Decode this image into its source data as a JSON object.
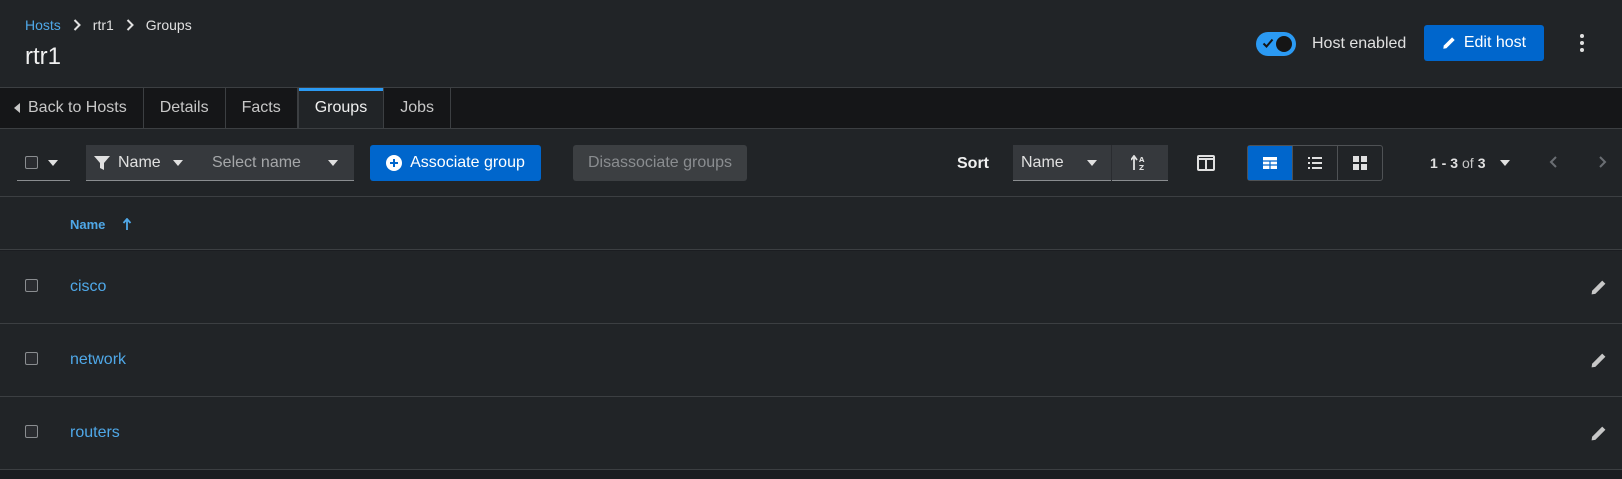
{
  "breadcrumb": {
    "items": [
      "Hosts",
      "rtr1",
      "Groups"
    ]
  },
  "header": {
    "title": "rtr1",
    "toggle_label": "Host enabled",
    "edit_button": "Edit host"
  },
  "tabs": [
    {
      "label": "Back to Hosts"
    },
    {
      "label": "Details"
    },
    {
      "label": "Facts"
    },
    {
      "label": "Groups"
    },
    {
      "label": "Jobs"
    }
  ],
  "toolbar": {
    "filter_label": "Name",
    "filter_placeholder": "Select name",
    "associate_button": "Associate group",
    "disassociate_button": "Disassociate groups",
    "sort_label": "Sort",
    "sort_value": "Name",
    "pagination": {
      "range": "1 - 3",
      "of": "of",
      "total": "3"
    }
  },
  "table": {
    "column_name": "Name",
    "rows": [
      {
        "name": "cisco"
      },
      {
        "name": "network"
      },
      {
        "name": "routers"
      }
    ]
  },
  "colors": {
    "accent": "#0066cc",
    "link": "#4fa8e8",
    "toggle": "#2b9af3",
    "background": "#212427"
  },
  "icons": {
    "toggle_check": "check-icon",
    "edit": "pencil-icon",
    "associate": "plus-circle-icon",
    "filter": "filter-icon",
    "sort_direction": "sort-alpha-asc-icon",
    "columns": "columns-icon",
    "views": [
      "table-view-icon",
      "list-view-icon",
      "grid-view-icon"
    ]
  }
}
